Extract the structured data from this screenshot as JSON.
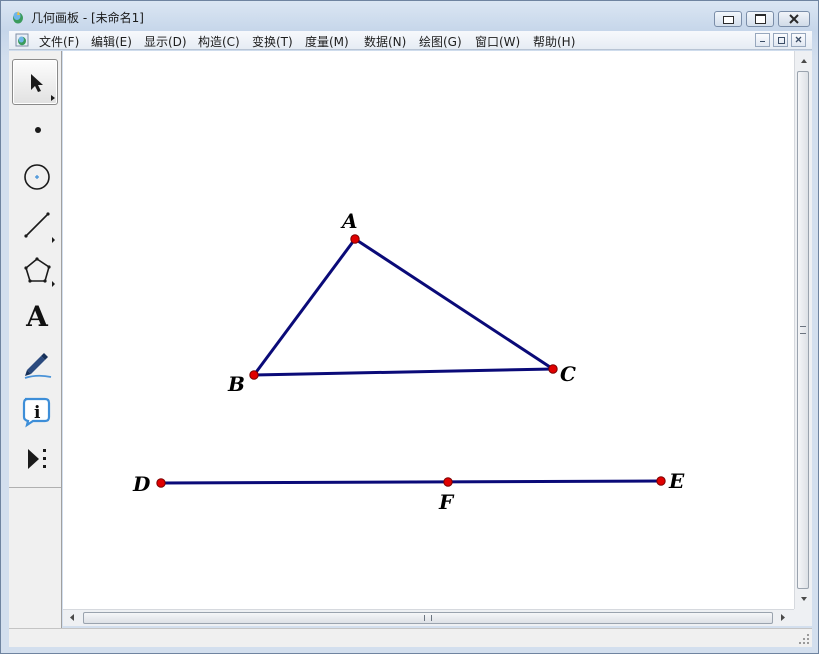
{
  "window": {
    "title": "几何画板 - [未命名1]"
  },
  "menu": {
    "items": [
      {
        "id": "file",
        "label": "文件(F)"
      },
      {
        "id": "edit",
        "label": "编辑(E)"
      },
      {
        "id": "display",
        "label": "显示(D)"
      },
      {
        "id": "construct",
        "label": "构造(C)"
      },
      {
        "id": "transform",
        "label": "变换(T)"
      },
      {
        "id": "measure",
        "label": "度量(M)"
      },
      {
        "id": "data",
        "label": "数据(N)"
      },
      {
        "id": "graph",
        "label": "绘图(G)"
      },
      {
        "id": "window",
        "label": "窗口(W)"
      },
      {
        "id": "help",
        "label": "帮助(H)"
      }
    ]
  },
  "toolbox": {
    "tools": [
      {
        "id": "arrow",
        "icon": "arrow-select-icon",
        "active": true
      },
      {
        "id": "point",
        "icon": "point-icon"
      },
      {
        "id": "compass",
        "icon": "circle-compass-icon"
      },
      {
        "id": "straightedge",
        "icon": "segment-icon"
      },
      {
        "id": "polygon",
        "icon": "polygon-icon"
      },
      {
        "id": "text",
        "icon": "text-tool-icon",
        "glyph": "A"
      },
      {
        "id": "marker",
        "icon": "marker-pen-icon"
      },
      {
        "id": "info",
        "icon": "info-icon",
        "glyph": "i"
      },
      {
        "id": "custom",
        "icon": "custom-tool-icon"
      }
    ]
  },
  "canvas": {
    "colors": {
      "line": "#0a0a78",
      "point_fill": "#e00000",
      "point_stroke": "#7a0000"
    },
    "points": [
      {
        "label": "A"
      },
      {
        "label": "B"
      },
      {
        "label": "C"
      },
      {
        "label": "D"
      },
      {
        "label": "E"
      },
      {
        "label": "F"
      }
    ]
  }
}
